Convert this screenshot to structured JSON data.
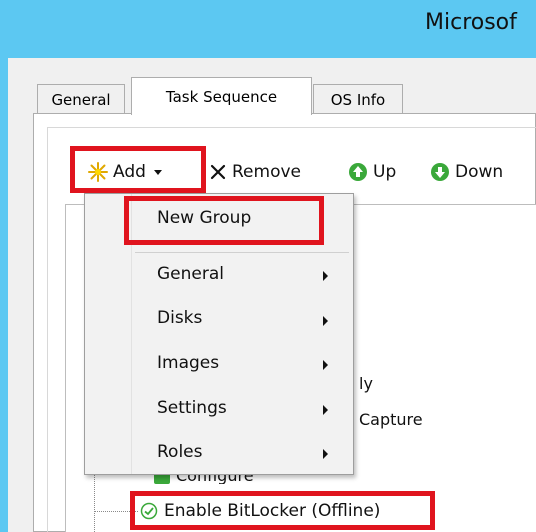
{
  "window": {
    "title": "Microsof"
  },
  "tabs": [
    {
      "label": "General",
      "active": false
    },
    {
      "label": "Task Sequence",
      "active": true
    },
    {
      "label": "OS Info",
      "active": false
    }
  ],
  "toolbar": {
    "add_label": "Add",
    "remove_label": "Remove",
    "up_label": "Up",
    "down_label": "Down"
  },
  "add_menu": {
    "items": [
      {
        "label": "New Group",
        "has_submenu": false
      },
      {
        "label": "General",
        "has_submenu": true
      },
      {
        "label": "Disks",
        "has_submenu": true
      },
      {
        "label": "Images",
        "has_submenu": true
      },
      {
        "label": "Settings",
        "has_submenu": true
      },
      {
        "label": "Roles",
        "has_submenu": true
      }
    ]
  },
  "tree": {
    "partial_texts": [
      "ly",
      "Capture",
      "Configure"
    ],
    "highlighted_item": {
      "label": "Enable BitLocker (Offline)",
      "status": "ok"
    }
  },
  "colors": {
    "title_bar": "#5cc8f2",
    "highlight": "#e0141e",
    "up_arrow": "#3aa83a",
    "check_green": "#3aa83a"
  }
}
